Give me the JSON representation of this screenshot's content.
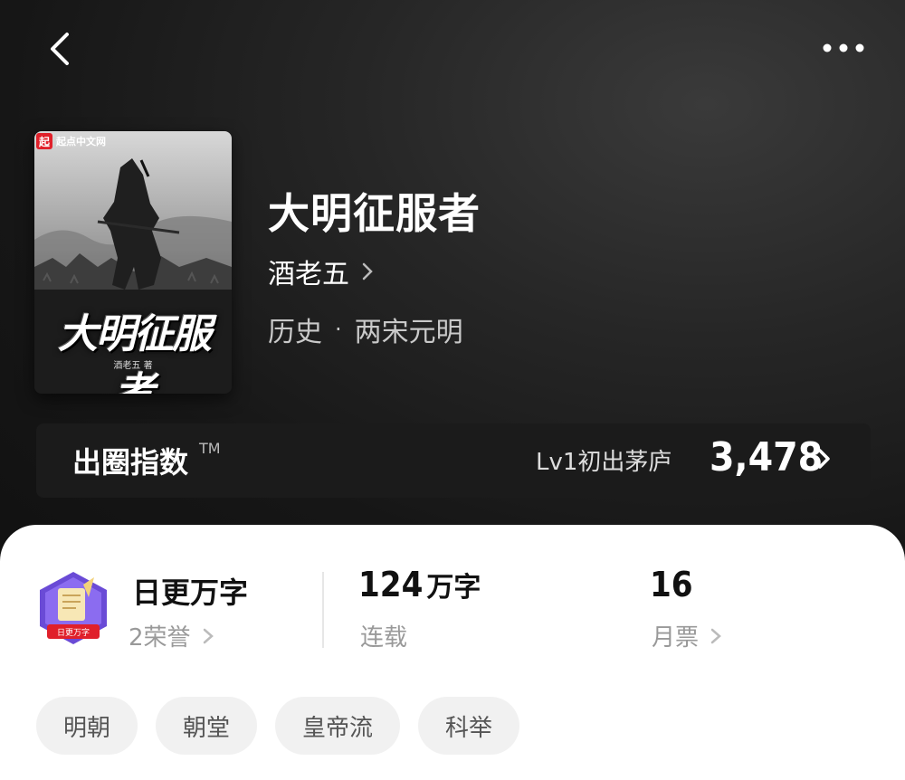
{
  "book": {
    "title": "大明征服者",
    "author": "酒老五",
    "category": "历史",
    "subcategory": "两宋元明",
    "cover": {
      "publisher": "起点中文网",
      "title": "大明征服者",
      "author_line": "酒老五 著"
    }
  },
  "index": {
    "label": "出圈指数",
    "trademark": "TM",
    "level": "Lv1初出茅庐",
    "score": "3,478"
  },
  "stats": {
    "honor": {
      "title": "日更万字",
      "badge_text": "日更万字",
      "sub": "2荣誉"
    },
    "words": {
      "value": "124",
      "unit": "万字",
      "sub": "连载"
    },
    "tickets": {
      "value": "16",
      "sub": "月票"
    }
  },
  "tags": [
    "明朝",
    "朝堂",
    "皇帝流",
    "科举"
  ],
  "colors": {
    "accent_red": "#e0202a",
    "badge_purple": "#6a4bd6",
    "sheet_bg": "#ffffff",
    "hero_bg": "#1a1a1a"
  },
  "icons": {
    "back": "chevron-left-icon",
    "more": "more-dots-icon",
    "arrow": "chevron-right-icon"
  }
}
